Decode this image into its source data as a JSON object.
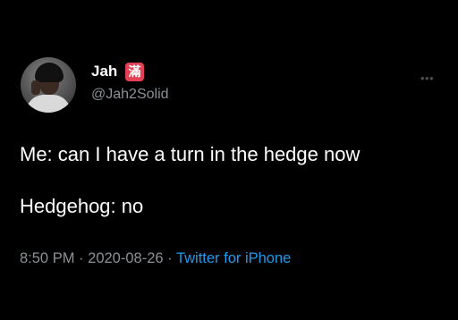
{
  "tweet": {
    "author": {
      "display_name": "Jah",
      "emoji": "滿",
      "handle": "@Jah2Solid"
    },
    "more_icon": "more-options-icon",
    "more_glyph": "•••",
    "text_lines": [
      "Me: can I have a turn in the hedge now",
      "Hedgehog: no"
    ],
    "meta": {
      "time": "8:50 PM",
      "separator": "·",
      "date": "2020-08-26",
      "source": "Twitter for iPhone"
    }
  },
  "colors": {
    "background": "#000000",
    "text": "#ffffff",
    "secondary": "#8b9196",
    "link": "#1d9bf0",
    "emoji_bg": "#e34058"
  }
}
